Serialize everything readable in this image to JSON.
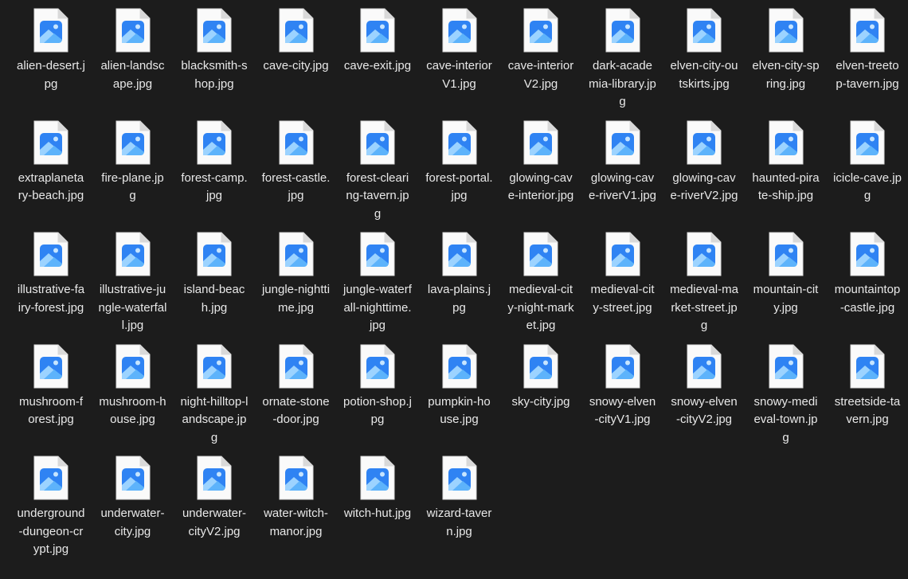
{
  "view": {
    "background": "#1c1c1c",
    "icon": "image-file-icon",
    "icon_colors": {
      "page": "#fafafa",
      "page_edge": "#d9d9d9",
      "picture_bg": "#2f83f3",
      "mountain_back": "#9cd3ff",
      "mountain_front": "#5db3fb",
      "sun": "#c6e5ff"
    }
  },
  "files": [
    "alien-desert.jpg",
    "alien-landscape.jpg",
    "blacksmith-shop.jpg",
    "cave-city.jpg",
    "cave-exit.jpg",
    "cave-interiorV1.jpg",
    "cave-interiorV2.jpg",
    "dark-academia-library.jpg",
    "elven-city-outskirts.jpg",
    "elven-city-spring.jpg",
    "elven-treetop-tavern.jpg",
    "extraplanetary-beach.jpg",
    "fire-plane.jpg",
    "forest-camp.jpg",
    "forest-castle.jpg",
    "forest-clearing-tavern.jpg",
    "forest-portal.jpg",
    "glowing-cave-interior.jpg",
    "glowing-cave-riverV1.jpg",
    "glowing-cave-riverV2.jpg",
    "haunted-pirate-ship.jpg",
    "icicle-cave.jpg",
    "illustrative-fairy-forest.jpg",
    "illustrative-jungle-waterfall.jpg",
    "island-beach.jpg",
    "jungle-nighttime.jpg",
    "jungle-waterfall-nighttime.jpg",
    "lava-plains.jpg",
    "medieval-city-night-market.jpg",
    "medieval-city-street.jpg",
    "medieval-market-street.jpg",
    "mountain-city.jpg",
    "mountaintop-castle.jpg",
    "mushroom-forest.jpg",
    "mushroom-house.jpg",
    "night-hilltop-landscape.jpg",
    "ornate-stone-door.jpg",
    "potion-shop.jpg",
    "pumpkin-house.jpg",
    "sky-city.jpg",
    "snowy-elven-cityV1.jpg",
    "snowy-elven-cityV2.jpg",
    "snowy-medieval-town.jpg",
    "streetside-tavern.jpg",
    "underground-dungeon-crypt.jpg",
    "underwater-city.jpg",
    "underwater-cityV2.jpg",
    "water-witch-manor.jpg",
    "witch-hut.jpg",
    "wizard-tavern.jpg"
  ]
}
